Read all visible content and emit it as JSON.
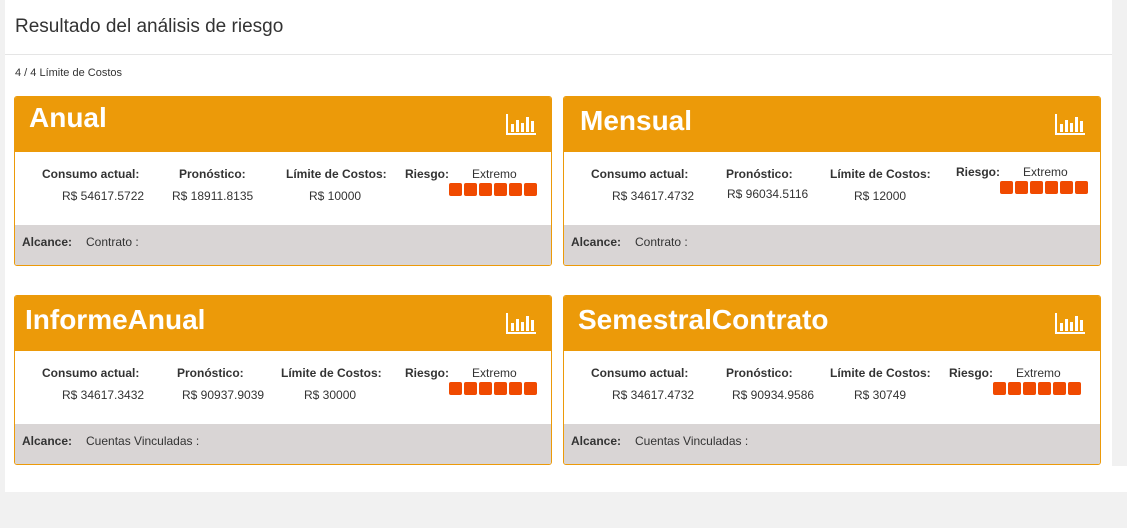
{
  "header": {
    "title": "Resultado del análisis de riesgo"
  },
  "subheader": {
    "count": "4 / 4 Límite de Costos"
  },
  "labels": {
    "consumo": "Consumo actual:",
    "pronostico": "Pronóstico:",
    "limite": "Límite de Costos:",
    "riesgo": "Riesgo:",
    "alcance": "Alcance:"
  },
  "cards": [
    {
      "title": "Anual",
      "consumo": "R$  54617.5722",
      "pronostico": "R$ 18911.8135",
      "limite": "R$ 10000",
      "riesgo": "Extremo",
      "alcance": "Contrato :"
    },
    {
      "title": "Mensual",
      "consumo": "R$ 34617.4732",
      "pronostico": "R$  96034.5116",
      "limite": "R$ 12000",
      "riesgo": "Extremo",
      "alcance": "Contrato :"
    },
    {
      "title": "InformeAnual",
      "consumo": "R$  34617.3432",
      "pronostico": "R$  90937.9039",
      "limite": "R$ 30000",
      "riesgo": "Extremo",
      "alcance": "Cuentas Vinculadas :"
    },
    {
      "title": "SemestralContrato",
      "consumo": "R$ 34617.4732",
      "pronostico": "R$ 90934.9586",
      "limite": "R$ 30749",
      "riesgo": "Extremo",
      "alcance": "Cuentas Vinculadas :"
    }
  ],
  "colors": {
    "accent": "#ec9a09",
    "risk": "#f04a00",
    "footer": "#d9d5d5"
  }
}
